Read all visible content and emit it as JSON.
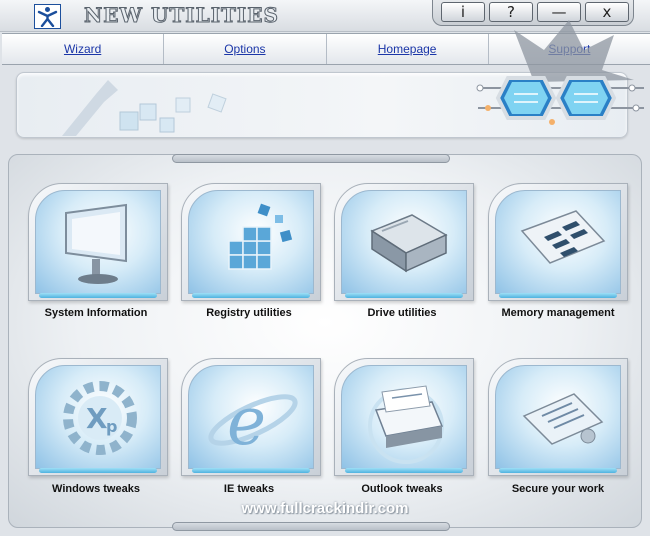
{
  "app": {
    "title": "NEW UTILITIES"
  },
  "window_buttons": [
    {
      "label": "i",
      "icon": "info-icon"
    },
    {
      "label": "?",
      "icon": "help-icon"
    },
    {
      "label": "—",
      "icon": "minimize-icon"
    },
    {
      "label": "x",
      "icon": "close-icon"
    }
  ],
  "nav": {
    "items": [
      {
        "label": "Wizard"
      },
      {
        "label": "Options"
      },
      {
        "label": "Homepage"
      },
      {
        "label": "Support"
      }
    ]
  },
  "tiles": [
    {
      "label": "System Information",
      "icon": "monitor-icon"
    },
    {
      "label": "Registry utilities",
      "icon": "cubes-icon"
    },
    {
      "label": "Drive utilities",
      "icon": "hard-drive-icon"
    },
    {
      "label": "Memory management",
      "icon": "memory-chip-icon"
    },
    {
      "label": "Windows tweaks",
      "icon": "xp-gear-icon"
    },
    {
      "label": "IE tweaks",
      "icon": "internet-explorer-icon"
    },
    {
      "label": "Outlook tweaks",
      "icon": "mail-icon"
    },
    {
      "label": "Secure your work",
      "icon": "certificate-icon"
    }
  ],
  "watermark": "www.fullcrackindir.com",
  "colors": {
    "link": "#1b36a8",
    "tile_blue": "#8fc2e6",
    "strip": "#4fb3e0"
  }
}
